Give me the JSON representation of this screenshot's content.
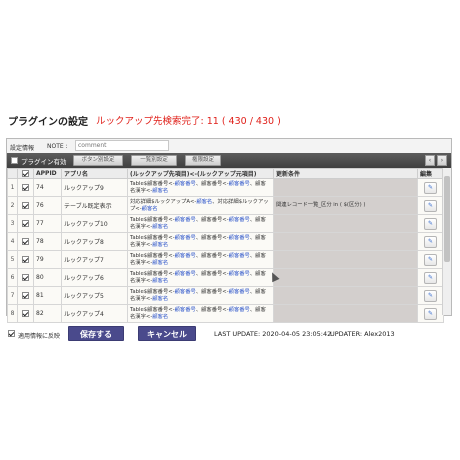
{
  "header": {
    "title": "プラグインの設定",
    "status": "ルックアップ先検索完了: 11 ( 430 / 430 )"
  },
  "meta": {
    "settings_label": "設定情報",
    "note_label": "NOTE :",
    "note_placeholder": "comment"
  },
  "toolbar": {
    "enable_label": "プラグイン有効",
    "buttons": [
      "ボタン別設定",
      "一覧別設定",
      "権限設定"
    ],
    "prev": "‹",
    "next": "›"
  },
  "table": {
    "columns": [
      "",
      "",
      "APPID",
      "アプリ名",
      "(ルックアップ先項目)<-(ルックアップ元項目)",
      "更新条件",
      "編集"
    ],
    "edit_icon": "pencil-icon",
    "rows": [
      {
        "num": "1",
        "appid": "74",
        "name": "ルックアップ9",
        "lookup": [
          {
            "t": "Table$顧客番号<-",
            "c": ""
          },
          {
            "t": "顧客番号",
            "c": "lk"
          },
          {
            "t": "、顧客番号<-",
            "c": ""
          },
          {
            "t": "顧客番号",
            "c": "lk"
          },
          {
            "t": "、顧客名漢字<-",
            "c": ""
          },
          {
            "t": "顧客名",
            "c": "lk"
          }
        ],
        "cond": ""
      },
      {
        "num": "2",
        "appid": "76",
        "name": "テーブル既定表示",
        "lookup": [
          {
            "t": "対応詳細$ルックアップA<-",
            "c": ""
          },
          {
            "t": "顧客名",
            "c": "lk"
          },
          {
            "t": "、対応詳細$ルックアップ<-",
            "c": ""
          },
          {
            "t": "顧客名",
            "c": "lk"
          }
        ],
        "cond": "関連レコード一覧_区分 in ( $(区分) )"
      },
      {
        "num": "3",
        "appid": "77",
        "name": "ルックアップ10",
        "lookup": [
          {
            "t": "Table$顧客番号<-",
            "c": ""
          },
          {
            "t": "顧客番号",
            "c": "lk"
          },
          {
            "t": "、顧客番号<-",
            "c": ""
          },
          {
            "t": "顧客番号",
            "c": "lk"
          },
          {
            "t": "、顧客名漢字<-",
            "c": ""
          },
          {
            "t": "顧客名",
            "c": "lk"
          }
        ],
        "cond": ""
      },
      {
        "num": "4",
        "appid": "78",
        "name": "ルックアップ8",
        "lookup": [
          {
            "t": "Table$顧客番号<-",
            "c": ""
          },
          {
            "t": "顧客番号",
            "c": "lk"
          },
          {
            "t": "、顧客番号<-",
            "c": ""
          },
          {
            "t": "顧客番号",
            "c": "lk"
          },
          {
            "t": "、顧客名漢字<-",
            "c": ""
          },
          {
            "t": "顧客名",
            "c": "lk"
          }
        ],
        "cond": ""
      },
      {
        "num": "5",
        "appid": "79",
        "name": "ルックアップ7",
        "lookup": [
          {
            "t": "Table$顧客番号<-",
            "c": ""
          },
          {
            "t": "顧客番号",
            "c": "lk"
          },
          {
            "t": "、顧客番号<-",
            "c": ""
          },
          {
            "t": "顧客番号",
            "c": "lk"
          },
          {
            "t": "、顧客名漢字<-",
            "c": ""
          },
          {
            "t": "顧客名",
            "c": "lk"
          }
        ],
        "cond": ""
      },
      {
        "num": "6",
        "appid": "80",
        "name": "ルックアップ6",
        "lookup": [
          {
            "t": "Table$顧客番号<-",
            "c": ""
          },
          {
            "t": "顧客番号",
            "c": "lk"
          },
          {
            "t": "、顧客番号<-",
            "c": ""
          },
          {
            "t": "顧客番号",
            "c": "lk"
          },
          {
            "t": "、顧客名漢字<-",
            "c": ""
          },
          {
            "t": "顧客名",
            "c": "lk"
          }
        ],
        "cond": ""
      },
      {
        "num": "7",
        "appid": "81",
        "name": "ルックアップ5",
        "lookup": [
          {
            "t": "Table$顧客番号<-",
            "c": ""
          },
          {
            "t": "顧客番号",
            "c": "lk"
          },
          {
            "t": "、顧客番号<-",
            "c": ""
          },
          {
            "t": "顧客番号",
            "c": "lk"
          },
          {
            "t": "、顧客名漢字<-",
            "c": ""
          },
          {
            "t": "顧客名",
            "c": "lk"
          }
        ],
        "cond": ""
      },
      {
        "num": "8",
        "appid": "82",
        "name": "ルックアップ4",
        "lookup": [
          {
            "t": "Table$顧客番号<-",
            "c": ""
          },
          {
            "t": "顧客番号",
            "c": "lk"
          },
          {
            "t": "、顧客番号<-",
            "c": ""
          },
          {
            "t": "顧客番号",
            "c": "lk"
          },
          {
            "t": "、顧客名漢字<-",
            "c": ""
          },
          {
            "t": "顧客名",
            "c": "lk"
          }
        ],
        "cond": ""
      }
    ]
  },
  "footer": {
    "apply_label": "適用情報に反映",
    "save_label": "保存する",
    "cancel_label": "キャンセル",
    "last_update": "LAST UPDATE: 2020-04-05 23:05:42",
    "updater": "UPDATER: Alex2013"
  },
  "colors": {
    "accent": "#4a4a8c",
    "status_text": "#e0201a",
    "link": "#2a52c9"
  }
}
